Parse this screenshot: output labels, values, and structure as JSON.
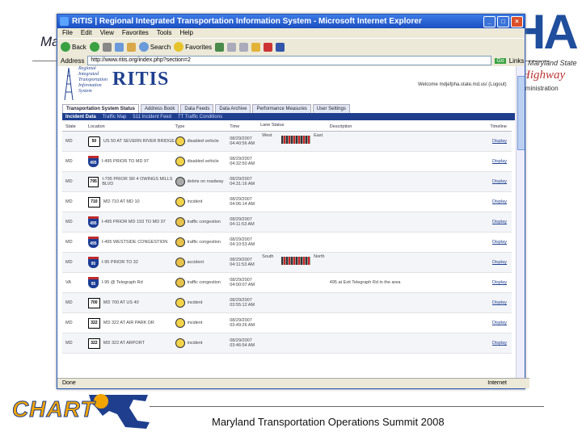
{
  "slide": {
    "title": "Ma",
    "footer": "Maryland Transportation Operations Summit 2008",
    "left_logo_text": "CHART",
    "right_logo": {
      "letters": "SHA",
      "sub1": "Maryland State",
      "sub2": "Highway",
      "sub3": "Administration"
    }
  },
  "window": {
    "title": "RITIS | Regional Integrated Transportation Information System - Microsoft Internet Explorer",
    "menu": [
      "File",
      "Edit",
      "View",
      "Favorites",
      "Tools",
      "Help"
    ],
    "toolbar": {
      "back": "Back",
      "search": "Search",
      "favorites": "Favorites"
    },
    "address_label": "Address",
    "address": "http://www.ritis.org/index.php?section=2",
    "go": "Go",
    "links": "Links",
    "status_left": "Done",
    "status_zone": "Internet"
  },
  "ritis": {
    "logo_small": [
      "Regional",
      "Integrated",
      "Transportation",
      "Information",
      "System"
    ],
    "logo_big": "RITIS",
    "user": "Welcome mdjefpha.state.md.us/  (Logout)",
    "tabs": [
      "Transportation System Status",
      "Address Book",
      "Data Feeds",
      "Data Archive",
      "Performance Measures",
      "User Settings"
    ],
    "subtabs": [
      "Incident Data",
      "Traffic Map",
      "511 Incident Feed",
      "TT Traffic Conditions"
    ],
    "columns": [
      "State",
      "Location",
      "Type",
      "Time",
      "Lane Status",
      "Description",
      "Timeline"
    ],
    "rows": [
      {
        "state": "MD",
        "shield": "50",
        "shield_type": "us",
        "location": "US 50 AT SEVERN RIVER BRIDGE",
        "type": "disabled vehicle",
        "icon_color": "#f3d34a",
        "time": "08/29/2007 04:40:56 AM",
        "lane_left": "West",
        "lane_right": "East",
        "lanes": true,
        "desc": "",
        "timeline": "Display"
      },
      {
        "state": "MD",
        "shield": "495",
        "shield_type": "i",
        "location": "I-495 PRIOR TO MD 97",
        "type": "disabled vehicle",
        "icon_color": "#f3d34a",
        "time": "08/29/2007 04:32:50 AM",
        "lane_left": "",
        "lane_right": "",
        "lanes": false,
        "desc": "",
        "timeline": "Display"
      },
      {
        "state": "MD",
        "shield": "795",
        "shield_type": "md",
        "location": "I-795 PRIOR SR 4 OWINGS MILLS BLVD",
        "type": "debris on roadway",
        "icon_color": "#aaaaaa",
        "time": "08/29/2007 04:31:16 AM",
        "lane_left": "",
        "lane_right": "",
        "lanes": false,
        "desc": "",
        "timeline": "Display"
      },
      {
        "state": "MD",
        "shield": "710",
        "shield_type": "md",
        "location": "MD 710 AT MD 10",
        "type": "incident",
        "icon_color": "#f3d34a",
        "time": "08/29/2007 04:06:14 AM",
        "lane_left": "",
        "lane_right": "",
        "lanes": false,
        "desc": "",
        "timeline": "Display"
      },
      {
        "state": "MD",
        "shield": "495",
        "shield_type": "i",
        "location": "I-495 PRIOR MD 193 TO MD 97",
        "type": "traffic congestion",
        "icon_color": "#e8c24a",
        "time": "08/29/2007 04:11:53 AM",
        "lane_left": "",
        "lane_right": "",
        "lanes": false,
        "desc": "",
        "timeline": "Display"
      },
      {
        "state": "MD",
        "shield": "495",
        "shield_type": "i",
        "location": "I-495 WESTSIDE CONGESTION",
        "type": "traffic congestion",
        "icon_color": "#e8c24a",
        "time": "08/29/2007 04:10:53 AM",
        "lane_left": "",
        "lane_right": "",
        "lanes": false,
        "desc": "",
        "timeline": "Display"
      },
      {
        "state": "MD",
        "shield": "95",
        "shield_type": "i",
        "location": "I-95 PRIOR TO 32",
        "type": "accident",
        "icon_color": "#e8c24a",
        "time": "08/29/2007 04:11:53 AM",
        "lane_left": "South",
        "lane_right": "North",
        "lanes": true,
        "desc": "",
        "timeline": "Display"
      },
      {
        "state": "VA",
        "shield": "95",
        "shield_type": "i",
        "location": "I-95 @ Telegraph Rd",
        "type": "traffic congestion",
        "icon_color": "#e8c24a",
        "time": "08/29/2007 04:00:07 AM",
        "lane_left": "",
        "lane_right": "",
        "lanes": false,
        "desc": "495 at Exit Telegraph Rd in the area",
        "timeline": "Display"
      },
      {
        "state": "MD",
        "shield": "700",
        "shield_type": "md",
        "location": "MD 700 AT US 40",
        "type": "incident",
        "icon_color": "#f3d34a",
        "time": "08/29/2007 03:55:12 AM",
        "lane_left": "",
        "lane_right": "",
        "lanes": false,
        "desc": "",
        "timeline": "Display"
      },
      {
        "state": "MD",
        "shield": "322",
        "shield_type": "md",
        "location": "MD 322 AT AIR PARK DR",
        "type": "incident",
        "icon_color": "#f3d34a",
        "time": "08/29/2007 03:49:26 AM",
        "lane_left": "",
        "lane_right": "",
        "lanes": false,
        "desc": "",
        "timeline": "Display"
      },
      {
        "state": "MD",
        "shield": "322",
        "shield_type": "md",
        "location": "MD 322 AT ARPORT",
        "type": "incident",
        "icon_color": "#f3d34a",
        "time": "08/29/2007 03:46:54 AM",
        "lane_left": "",
        "lane_right": "",
        "lanes": false,
        "desc": "",
        "timeline": "Display"
      }
    ]
  }
}
